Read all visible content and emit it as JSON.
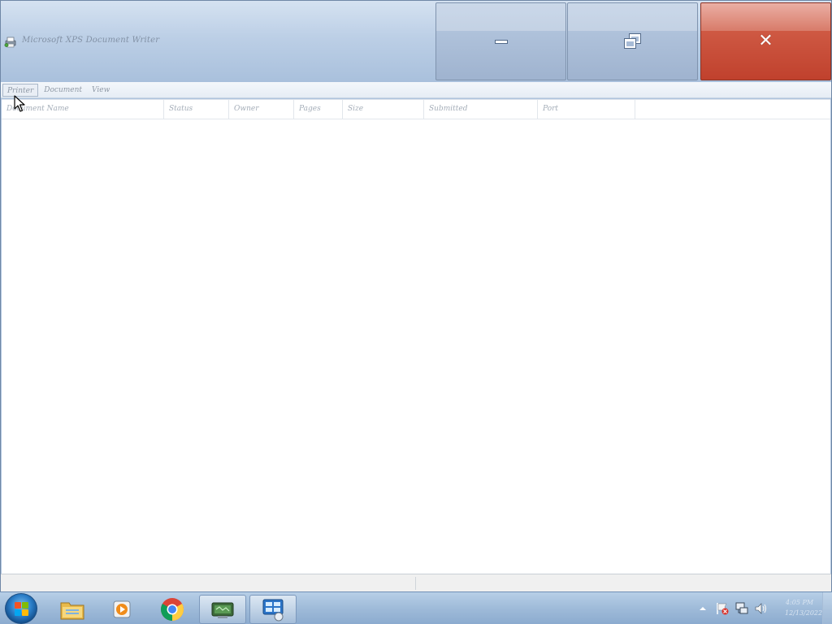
{
  "window": {
    "title": "Microsoft XPS Document Writer",
    "title_icon": "printer-icon",
    "controls": {
      "minimize_icon": "minimize-icon",
      "maximize_icon": "restore-icon",
      "close_icon": "close-icon",
      "close_color": "#c7472f"
    }
  },
  "menu": {
    "items": [
      {
        "label": "Printer",
        "active": true
      },
      {
        "label": "Document",
        "active": false
      },
      {
        "label": "View",
        "active": false
      }
    ]
  },
  "queue": {
    "columns": [
      {
        "label": "Document Name"
      },
      {
        "label": "Status"
      },
      {
        "label": "Owner"
      },
      {
        "label": "Pages"
      },
      {
        "label": "Size"
      },
      {
        "label": "Submitted"
      },
      {
        "label": "Port"
      },
      {
        "label": ""
      }
    ],
    "rows": []
  },
  "statusbar": {
    "left_text": "",
    "right_text": ""
  },
  "taskbar": {
    "start_icon": "windows-start-orb",
    "pinned": [
      {
        "name": "windows-explorer-icon",
        "open": false
      },
      {
        "name": "media-player-icon",
        "open": false
      },
      {
        "name": "chrome-icon",
        "open": false
      },
      {
        "name": "devices-printers-icon",
        "open": true
      },
      {
        "name": "print-queue-icon",
        "open": true
      }
    ],
    "tray": {
      "icons": [
        "show-hidden-icons-arrow",
        "action-center-flag-icon",
        "network-icon",
        "volume-icon"
      ],
      "time": "4:05 PM",
      "date": "12/13/2022"
    }
  }
}
